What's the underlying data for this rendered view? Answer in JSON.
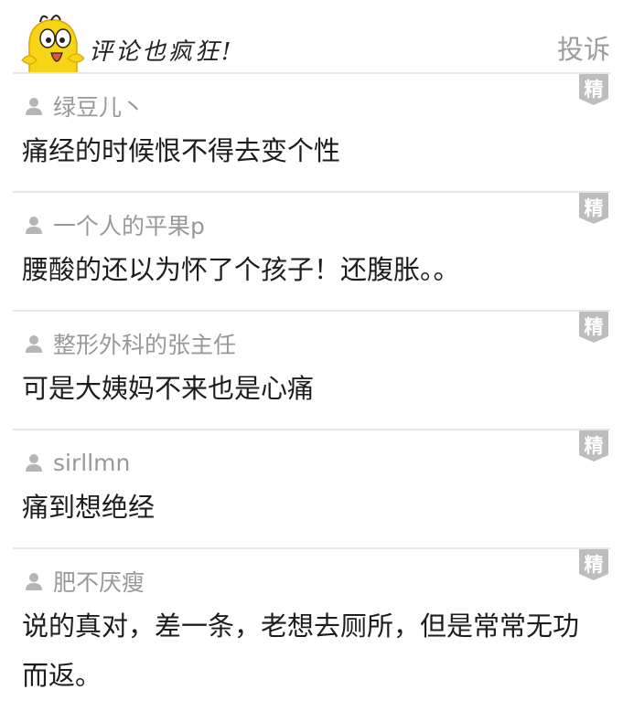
{
  "header": {
    "title": "评论也疯狂!",
    "report_label": "投诉"
  },
  "badge_label": "精",
  "colors": {
    "badge": "#bdbdbd",
    "divider": "#e6e6e6",
    "username": "#999999",
    "text": "#1d1d1d",
    "report": "#9c9c9c",
    "mascot": "#f7d417"
  },
  "comments": [
    {
      "user": "绿豆儿丶",
      "text": "痛经的时候恨不得去变个性"
    },
    {
      "user": "一个人的平果p",
      "text": "腰酸的还以为怀了个孩子！还腹胀。。"
    },
    {
      "user": "整形外科的张主任",
      "text": "可是大姨妈不来也是心痛"
    },
    {
      "user": "sirllmn",
      "text": "痛到想绝经"
    },
    {
      "user": "肥不厌瘦",
      "text": "说的真对，差一条，老想去厕所，但是常常无功而返。"
    }
  ]
}
